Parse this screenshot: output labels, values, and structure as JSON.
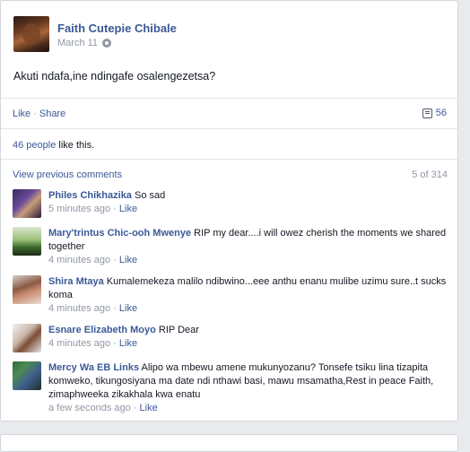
{
  "post": {
    "author": "Faith Cutepie Chibale",
    "date": "March 11",
    "text": "Akuti ndafa,ine ndingafe osalengezetsa?",
    "like_label": "Like",
    "share_label": "Share",
    "comment_count": "56",
    "likes_count": "46 people",
    "likes_suffix": " like this."
  },
  "comments": {
    "view_previous": "View previous comments",
    "pager": "5 of 314",
    "like_label": "Like",
    "items": [
      {
        "name": "Philes Chikhazika",
        "text": " So sad",
        "time": "5 minutes ago"
      },
      {
        "name": "Mary'trintus Chic-ooh Mwenye",
        "text": " RIP my dear....i will owez cherish the moments we shared together",
        "time": "4 minutes ago"
      },
      {
        "name": "Shira Mtaya",
        "text": " Kumalemekeza malilo ndibwino...eee anthu enanu mulibe uzimu sure..t sucks koma",
        "time": "4 minutes ago"
      },
      {
        "name": "Esnare Elizabeth Moyo",
        "text": " RIP Dear",
        "time": "4 minutes ago"
      },
      {
        "name": "Mercy Wa EB Links",
        "text": " Alipo wa mbewu amene mukunyozanu? Tonsefe tsiku lina tizapita komweko, tikungosiyana ma date ndi nthawi basi, mawu msamatha,Rest in peace Faith, zimaphweeka zikakhala kwa enatu",
        "time": "a few seconds ago"
      }
    ]
  },
  "icons": {
    "privacy": "globe-icon",
    "comments": "comment-icon"
  }
}
